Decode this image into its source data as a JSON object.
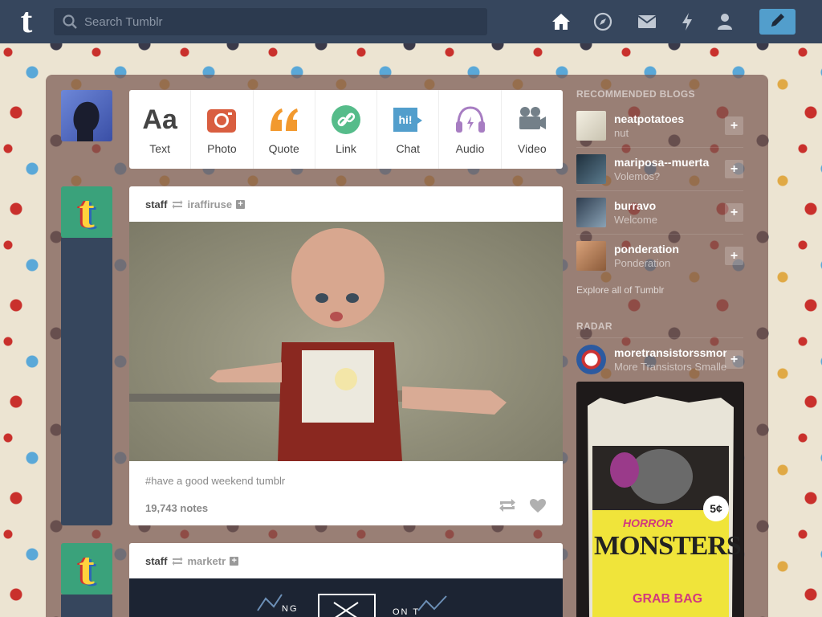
{
  "header": {
    "search_placeholder": "Search Tumblr",
    "nav_icons": [
      "home-icon",
      "explore-icon",
      "inbox-icon",
      "activity-icon",
      "account-icon"
    ],
    "compose_icon": "pencil-icon",
    "colors": {
      "bar": "#36465d",
      "compose": "#529ecc"
    }
  },
  "post_types": [
    {
      "label": "Text",
      "icon": "text-icon",
      "color": "#444444"
    },
    {
      "label": "Photo",
      "icon": "camera-icon",
      "color": "#d95e40"
    },
    {
      "label": "Quote",
      "icon": "quote-icon",
      "color": "#f2992e"
    },
    {
      "label": "Link",
      "icon": "link-icon",
      "color": "#56bc8a"
    },
    {
      "label": "Chat",
      "icon": "chat-icon",
      "color": "#529ecc"
    },
    {
      "label": "Audio",
      "icon": "headphones-icon",
      "color": "#a77dc2"
    },
    {
      "label": "Video",
      "icon": "video-camera-icon",
      "color": "#748089"
    }
  ],
  "posts": [
    {
      "author": "staff",
      "source": "iraffiruse",
      "tags": "#have a good weekend tumblr",
      "notes": "19,743 notes"
    },
    {
      "author": "staff",
      "source": "marketr"
    }
  ],
  "sidebar": {
    "recommended_title": "RECOMMENDED BLOGS",
    "recommended": [
      {
        "name": "neatpotatoes",
        "desc": "nut"
      },
      {
        "name": "mariposa--muerta",
        "desc": "Volemos?"
      },
      {
        "name": "burravo",
        "desc": "Welcome"
      },
      {
        "name": "ponderation",
        "desc": "Ponderation"
      }
    ],
    "explore_link": "Explore all of Tumblr",
    "radar_title": "RADAR",
    "radar": {
      "name": "moretransistorssmoref",
      "desc": "More Transistors Smaller"
    },
    "radar_image_text": {
      "price": "5¢",
      "line1": "HORROR",
      "line2": "MONSTERS",
      "line3": "GRAB BAG"
    }
  },
  "second_post_banner": {
    "left": "NG",
    "right": "ON T"
  }
}
